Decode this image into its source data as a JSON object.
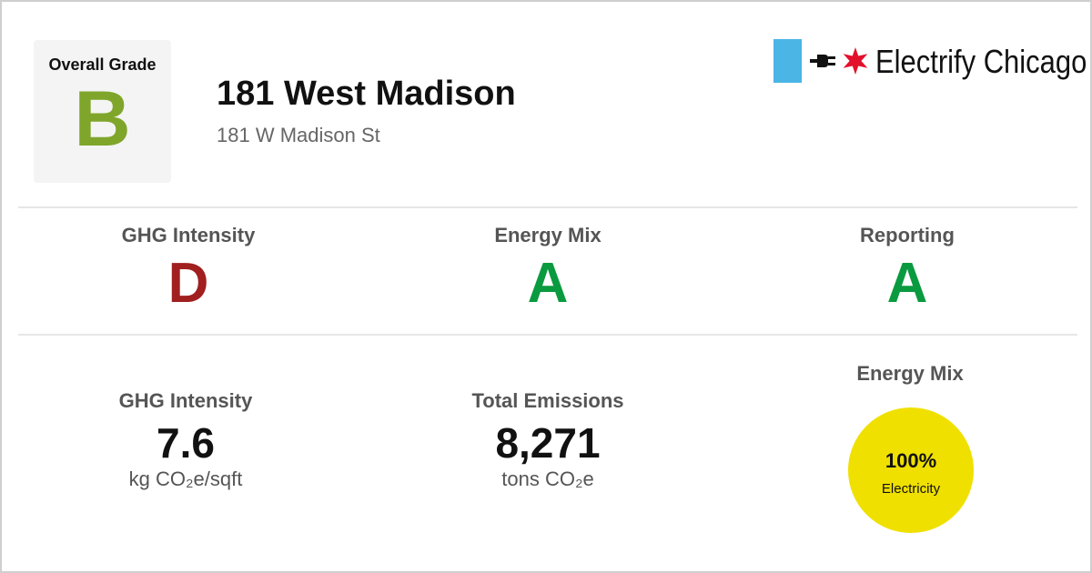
{
  "colors": {
    "grade_b": "#7fa62b",
    "grade_d": "#a11f1f",
    "grade_a": "#0a9a3f",
    "brand_bar": "#4bb5e6",
    "brand_star": "#e3102b",
    "mix_circle": "#f0e000"
  },
  "overall": {
    "label": "Overall Grade",
    "grade": "B"
  },
  "building": {
    "name": "181 West Madison",
    "address": "181 W Madison St"
  },
  "brand": {
    "name": "Electrify Chicago",
    "icons": [
      "plug-icon",
      "star-icon"
    ]
  },
  "grades": [
    {
      "title": "GHG Intensity",
      "grade": "D"
    },
    {
      "title": "Energy Mix",
      "grade": "A"
    },
    {
      "title": "Reporting",
      "grade": "A"
    }
  ],
  "stats": {
    "ghg_intensity": {
      "title": "GHG Intensity",
      "value": "7.6",
      "unit": "kg CO₂e/sqft"
    },
    "total_emissions": {
      "title": "Total Emissions",
      "value": "8,271",
      "unit": "tons CO₂e"
    }
  },
  "energy_mix": {
    "title": "Energy Mix",
    "percent": "100%",
    "source": "Electricity"
  }
}
